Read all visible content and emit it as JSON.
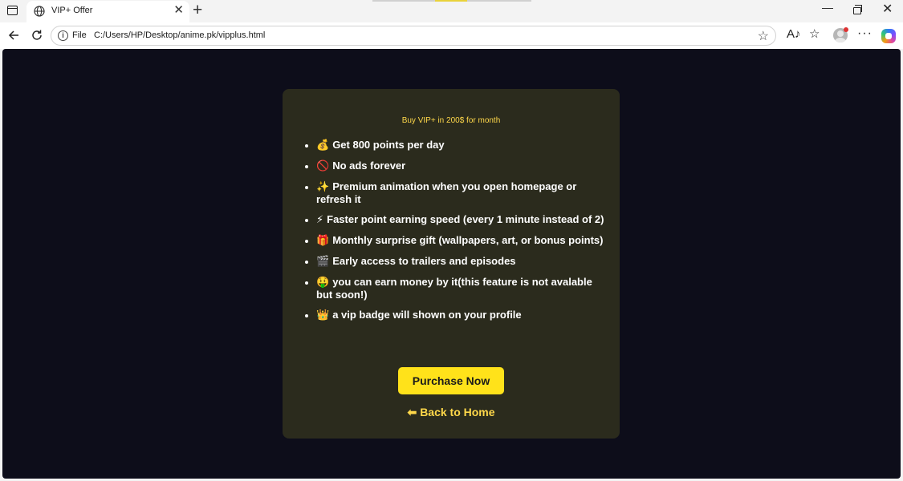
{
  "browser": {
    "tab_title": "VIP+ Offer",
    "tab_close": "✕",
    "new_tab": "+",
    "scheme_label": "File",
    "url": "C:/Users/HP/Desktop/anime.pk/vipplus.html",
    "icons": [
      "sidebar-icon",
      "globe-icon",
      "back-arrow-icon",
      "reload-icon",
      "info-icon",
      "star-icon",
      "read-aloud-icon",
      "favorites-icon",
      "profile-icon",
      "more-icon",
      "copilot-icon"
    ]
  },
  "offer": {
    "title": "Buy VIP+ in 200$ for month",
    "benefits": [
      {
        "emoji": "💰",
        "text": "Get 800 points per day"
      },
      {
        "emoji": "🚫",
        "text": "No ads forever"
      },
      {
        "emoji": "✨",
        "text": "Premium animation when you open homepage or refresh it"
      },
      {
        "emoji": "⚡",
        "text": "Faster point earning speed (every 1 minute instead of 2)"
      },
      {
        "emoji": "🎁",
        "text": "Monthly surprise gift (wallpapers, art, or bonus points)"
      },
      {
        "emoji": "🎬",
        "text": "Early access to trailers and episodes"
      },
      {
        "emoji": "🤑",
        "text": "you can earn money by it(this feature is not avalable but soon!)"
      },
      {
        "emoji": "👑",
        "text": "a vip badge will shown on your profile"
      }
    ],
    "purchase_label": "Purchase Now",
    "back_arrow": "⬅",
    "back_label": "Back to Home"
  },
  "colors": {
    "page_background": "#0d0d1a",
    "card_background": "#2b2b1d",
    "accent_yellow": "#ffe21a",
    "title_yellow": "#ffd84a"
  }
}
